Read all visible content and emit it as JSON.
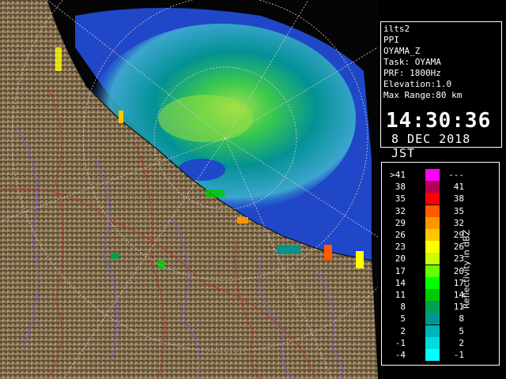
{
  "info": {
    "lines": [
      "ilts2",
      "PPI",
      "OYAMA_Z",
      "Task: OYAMA",
      "PRF: 1800Hz",
      "Elevation:1.0",
      "Max Range:80 km"
    ],
    "time": "14:30:36",
    "date": "8 DEC 2018 JST"
  },
  "legend": {
    "unit": "Reflectivity in dBZ",
    "rows": [
      {
        "left": ">41",
        "right": "---",
        "color": "#ff00ff"
      },
      {
        "left": "38",
        "right": "41",
        "color": "#b40050"
      },
      {
        "left": "35",
        "right": "38",
        "color": "#ff0000"
      },
      {
        "left": "32",
        "right": "35",
        "color": "#ff5a00"
      },
      {
        "left": "29",
        "right": "32",
        "color": "#ff9600"
      },
      {
        "left": "26",
        "right": "29",
        "color": "#ffc800"
      },
      {
        "left": "23",
        "right": "26",
        "color": "#ffff00"
      },
      {
        "left": "20",
        "right": "23",
        "color": "#c8ff00"
      },
      {
        "left": "17",
        "right": "20",
        "color": "#64ff00"
      },
      {
        "left": "14",
        "right": "17",
        "color": "#00ff00"
      },
      {
        "left": "11",
        "right": "14",
        "color": "#00c800"
      },
      {
        "left": "8",
        "right": "11",
        "color": "#00a050"
      },
      {
        "left": "5",
        "right": "8",
        "color": "#009696"
      },
      {
        "left": "2",
        "right": "5",
        "color": "#00b4b4"
      },
      {
        "left": "-1",
        "right": "2",
        "color": "#00dcdc"
      },
      {
        "left": "-4",
        "right": "-1",
        "color": "#00ffff"
      }
    ]
  },
  "map": {
    "sea_color": "#1f47c8",
    "land_color": "#8a7556"
  }
}
